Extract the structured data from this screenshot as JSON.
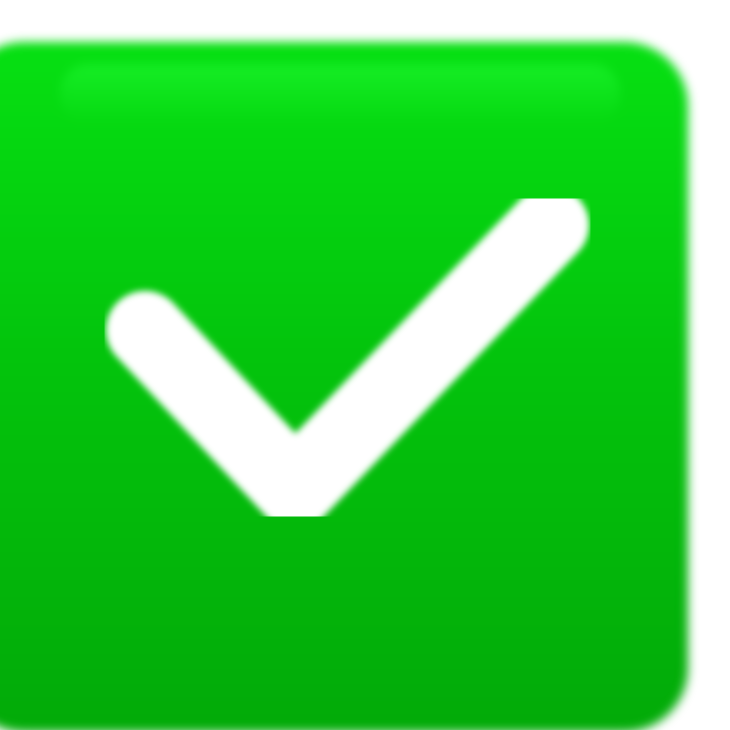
{
  "control": {
    "type": "checkbox",
    "state": "checked",
    "icon": "checkmark-icon",
    "colors": {
      "fill_top": "#06e012",
      "fill_bottom": "#02aa08",
      "check": "#ffffff"
    }
  }
}
